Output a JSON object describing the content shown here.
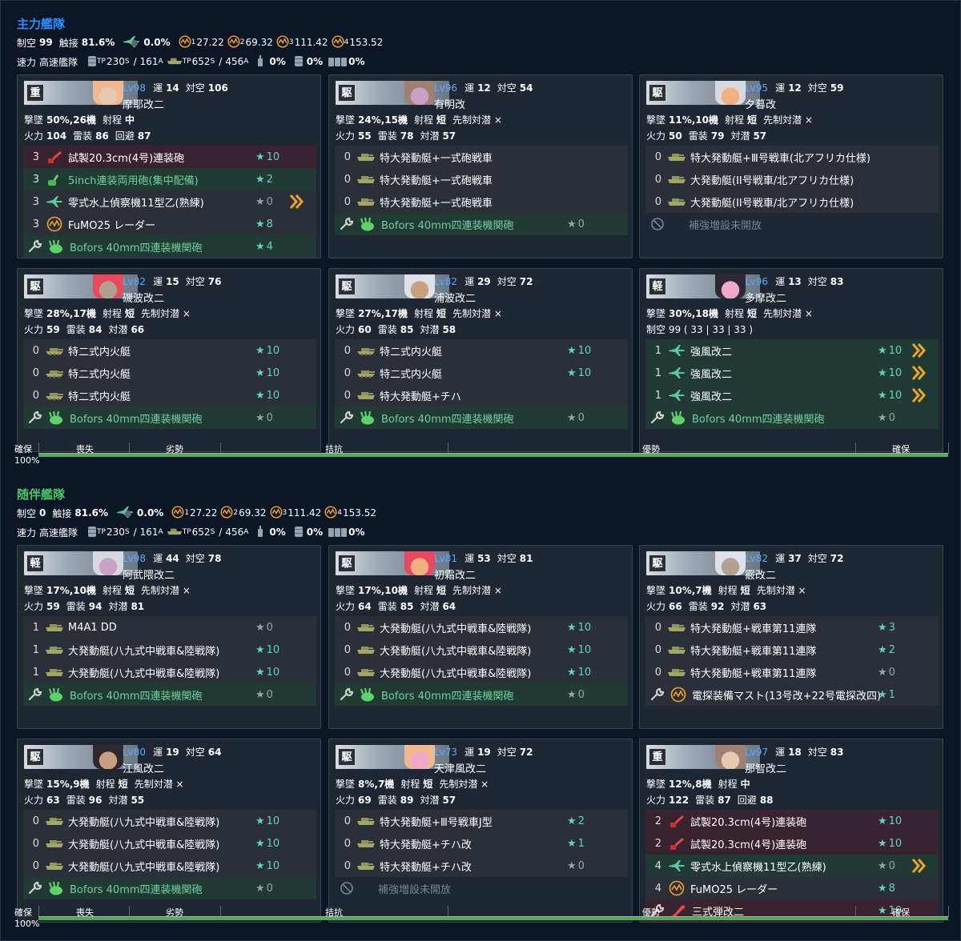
{
  "colors": {
    "main_title": "#2f8fff",
    "escort_title": "#4cc46b",
    "level": "#5fa8ff",
    "star": "#5fd4c4",
    "bar": "#58a85a"
  },
  "fleets": [
    {
      "title": "主力艦隊",
      "air": "99",
      "contact": "81.6%",
      "loss": "0.0%",
      "ls1": "27.22",
      "ls2": "69.32",
      "ls3": "111.42",
      "ls4": "153.52",
      "speed": "高速艦隊",
      "tp_s": "230",
      "tp_a": "161",
      "tp2_s": "652",
      "tp2_a": "456",
      "d1": "0%",
      "d2": "0%",
      "d3": "0%",
      "labels": {
        "air": "制空",
        "contact": "触接",
        "speed": "速力",
        "s1": "1",
        "s2": "2",
        "s3": "3",
        "s4": "4",
        "tp": "TP",
        "s": "S",
        "a": "A",
        "slash": "/"
      },
      "bar": {
        "kakuho": "確保",
        "soushitsu": "喪失",
        "ressei": "劣勢",
        "kikou": "拮抗",
        "yusei": "優勢",
        "kakuho2": "確保",
        "pct": "100%"
      },
      "ships": [
        {
          "type": "重",
          "lv": "Lv98",
          "luck": "14",
          "asw_label": "対空",
          "asw": "106",
          "name": "摩耶改二",
          "l2": "撃墜",
          "l2v": "50%,26機",
          "range_label": "射程",
          "range": "中",
          "extra": "",
          "stats": [
            [
              "火力",
              "104"
            ],
            [
              "雷装",
              "86"
            ],
            [
              "回避",
              "87"
            ]
          ],
          "row4": "",
          "slots": [
            {
              "c": "3",
              "ic": "gun-red",
              "bg": "bg-red",
              "n": "試製20.3cm(4号)連装砲",
              "st": "10",
              "g": false,
              "p": false
            },
            {
              "c": "3",
              "ic": "gun-green",
              "bg": "bg-green",
              "n": "5inch連装両用砲(集中配備)",
              "st": "2",
              "g": false,
              "p": false,
              "ncls": "ex-green"
            },
            {
              "c": "3",
              "ic": "plane-green",
              "bg": "bg-dark",
              "n": "零式水上偵察機11型乙(熟練)",
              "st": "0",
              "g": true,
              "p": true
            },
            {
              "c": "3",
              "ic": "radar",
              "bg": "bg-dark",
              "n": "FuMO25 レーダー",
              "st": "8",
              "g": false,
              "p": false
            }
          ],
          "ex": {
            "ic": "aa-green",
            "n": "Bofors 40mm四連装機関砲",
            "st": "4",
            "g": false
          }
        },
        {
          "type": "駆",
          "lv": "Lv96",
          "luck": "12",
          "asw_label": "対空",
          "asw": "54",
          "name": "有明改",
          "l2": "撃墜",
          "l2v": "24%,15機",
          "range_label": "射程",
          "range": "短",
          "extra": "先制対潜 ×",
          "stats": [
            [
              "火力",
              "55"
            ],
            [
              "雷装",
              "78"
            ],
            [
              "対潜",
              "57"
            ]
          ],
          "row4": "",
          "slots": [
            {
              "c": "0",
              "ic": "boat",
              "bg": "bg-dark",
              "n": "特大発動艇+一式砲戦車",
              "st": "",
              "g": false,
              "p": false
            },
            {
              "c": "0",
              "ic": "boat",
              "bg": "bg-dark",
              "n": "特大発動艇+一式砲戦車",
              "st": "",
              "g": false,
              "p": false
            },
            {
              "c": "0",
              "ic": "boat",
              "bg": "bg-dark",
              "n": "特大発動艇+一式砲戦車",
              "st": "",
              "g": false,
              "p": false
            }
          ],
          "ex": {
            "ic": "aa-green",
            "n": "Bofors 40mm四連装機関砲",
            "st": "0",
            "g": true
          }
        },
        {
          "type": "駆",
          "lv": "Lv95",
          "luck": "12",
          "asw_label": "対空",
          "asw": "59",
          "name": "夕暮改",
          "l2": "撃墜",
          "l2v": "11%,10機",
          "range_label": "射程",
          "range": "短",
          "extra": "先制対潜 ×",
          "stats": [
            [
              "火力",
              "50"
            ],
            [
              "雷装",
              "79"
            ],
            [
              "対潜",
              "57"
            ]
          ],
          "row4": "",
          "slots": [
            {
              "c": "0",
              "ic": "boat",
              "bg": "bg-dark",
              "n": "特大発動艇+Ⅲ号戦車(北アフリカ仕様)",
              "st": "",
              "g": false,
              "p": false
            },
            {
              "c": "0",
              "ic": "boat",
              "bg": "bg-dark",
              "n": "大発動艇(II号戦車/北アフリカ仕様)",
              "st": "",
              "g": false,
              "p": false
            },
            {
              "c": "0",
              "ic": "boat",
              "bg": "bg-dark",
              "n": "大発動艇(II号戦車/北アフリカ仕様)",
              "st": "",
              "g": false,
              "p": false
            }
          ],
          "ex": {
            "ic": "none",
            "n": "補強増設未開放",
            "st": "",
            "g": false,
            "closed": true
          }
        },
        {
          "type": "駆",
          "lv": "Lv82",
          "luck": "15",
          "asw_label": "対空",
          "asw": "76",
          "name": "磯波改二",
          "l2": "撃墜",
          "l2v": "28%,17機",
          "range_label": "射程",
          "range": "短",
          "extra": "先制対潜 ×",
          "stats": [
            [
              "火力",
              "59"
            ],
            [
              "雷装",
              "84"
            ],
            [
              "対潜",
              "66"
            ]
          ],
          "row4": "",
          "slots": [
            {
              "c": "0",
              "ic": "boat2",
              "bg": "bg-dark",
              "n": "特二式内火艇",
              "st": "10",
              "g": false,
              "p": false
            },
            {
              "c": "0",
              "ic": "boat2",
              "bg": "bg-dark",
              "n": "特二式内火艇",
              "st": "10",
              "g": false,
              "p": false
            },
            {
              "c": "0",
              "ic": "boat2",
              "bg": "bg-dark",
              "n": "特二式内火艇",
              "st": "10",
              "g": false,
              "p": false
            }
          ],
          "ex": {
            "ic": "aa-green",
            "n": "Bofors 40mm四連装機関砲",
            "st": "0",
            "g": true
          }
        },
        {
          "type": "駆",
          "lv": "Lv82",
          "luck": "29",
          "asw_label": "対空",
          "asw": "72",
          "name": "浦波改二",
          "l2": "撃墜",
          "l2v": "27%,17機",
          "range_label": "射程",
          "range": "短",
          "extra": "先制対潜 ×",
          "stats": [
            [
              "火力",
              "60"
            ],
            [
              "雷装",
              "85"
            ],
            [
              "対潜",
              "58"
            ]
          ],
          "row4": "",
          "slots": [
            {
              "c": "0",
              "ic": "boat2",
              "bg": "bg-dark",
              "n": "特二式内火艇",
              "st": "10",
              "g": false,
              "p": false
            },
            {
              "c": "0",
              "ic": "boat2",
              "bg": "bg-dark",
              "n": "特二式内火艇",
              "st": "10",
              "g": false,
              "p": false
            },
            {
              "c": "0",
              "ic": "boat",
              "bg": "bg-dark",
              "n": "特大発動艇+チハ",
              "st": "",
              "g": false,
              "p": false
            }
          ],
          "ex": {
            "ic": "aa-green",
            "n": "Bofors 40mm四連装機関砲",
            "st": "0",
            "g": true
          }
        },
        {
          "type": "軽",
          "lv": "Lv96",
          "luck": "13",
          "asw_label": "対空",
          "asw": "83",
          "name": "多摩改二",
          "l2": "撃墜",
          "l2v": "30%,18機",
          "range_label": "射程",
          "range": "短",
          "extra": "先制対潜 ×",
          "stats": [],
          "row4": "制空 99 ( 33 | 33 | 33 )",
          "slots": [
            {
              "c": "1",
              "ic": "plane-green",
              "bg": "bg-green",
              "n": "強風改二",
              "st": "10",
              "g": false,
              "p": true
            },
            {
              "c": "1",
              "ic": "plane-green",
              "bg": "bg-green",
              "n": "強風改二",
              "st": "10",
              "g": false,
              "p": true
            },
            {
              "c": "1",
              "ic": "plane-green",
              "bg": "bg-green",
              "n": "強風改二",
              "st": "10",
              "g": false,
              "p": true
            }
          ],
          "ex": {
            "ic": "aa-green",
            "n": "Bofors 40mm四連装機関砲",
            "st": "0",
            "g": true
          }
        }
      ]
    },
    {
      "title": "随伴艦隊",
      "air": "0",
      "contact": "81.6%",
      "loss": "0.0%",
      "ls1": "27.22",
      "ls2": "69.32",
      "ls3": "111.42",
      "ls4": "153.52",
      "speed": "高速艦隊",
      "tp_s": "230",
      "tp_a": "161",
      "tp2_s": "652",
      "tp2_a": "456",
      "d1": "0%",
      "d2": "0%",
      "d3": "0%",
      "labels": {
        "air": "制空",
        "contact": "触接",
        "speed": "速力",
        "s1": "1",
        "s2": "2",
        "s3": "3",
        "s4": "4",
        "tp": "TP",
        "s": "S",
        "a": "A",
        "slash": "/"
      },
      "bar": {
        "kakuho": "確保",
        "soushitsu": "喪失",
        "ressei": "劣勢",
        "kikou": "拮抗",
        "yusei": "優勢",
        "kakuho2": "確保",
        "pct": "100%"
      },
      "ships": [
        {
          "type": "軽",
          "lv": "Lv98",
          "luck": "44",
          "asw_label": "対空",
          "asw": "78",
          "name": "阿武隈改二",
          "l2": "撃墜",
          "l2v": "17%,10機",
          "range_label": "射程",
          "range": "短",
          "extra": "先制対潜 ×",
          "stats": [
            [
              "火力",
              "59"
            ],
            [
              "雷装",
              "94"
            ],
            [
              "対潜",
              "81"
            ]
          ],
          "row4": "",
          "slots": [
            {
              "c": "1",
              "ic": "boat",
              "bg": "bg-dark",
              "n": "M4A1 DD",
              "st": "0",
              "g": true,
              "p": false
            },
            {
              "c": "1",
              "ic": "boat",
              "bg": "bg-dark",
              "n": "大発動艇(八九式中戦車&陸戦隊)",
              "st": "10",
              "g": false,
              "p": false
            },
            {
              "c": "1",
              "ic": "boat",
              "bg": "bg-dark",
              "n": "大発動艇(八九式中戦車&陸戦隊)",
              "st": "10",
              "g": false,
              "p": false
            }
          ],
          "ex": {
            "ic": "aa-green",
            "n": "Bofors 40mm四連装機関砲",
            "st": "0",
            "g": true
          }
        },
        {
          "type": "駆",
          "lv": "Lv81",
          "luck": "53",
          "asw_label": "対空",
          "asw": "81",
          "name": "初霜改二",
          "l2": "撃墜",
          "l2v": "17%,10機",
          "range_label": "射程",
          "range": "短",
          "extra": "先制対潜 ×",
          "stats": [
            [
              "火力",
              "64"
            ],
            [
              "雷装",
              "85"
            ],
            [
              "対潜",
              "64"
            ]
          ],
          "row4": "",
          "slots": [
            {
              "c": "0",
              "ic": "boat",
              "bg": "bg-dark",
              "n": "大発動艇(八九式中戦車&陸戦隊)",
              "st": "10",
              "g": false,
              "p": false
            },
            {
              "c": "0",
              "ic": "boat",
              "bg": "bg-dark",
              "n": "大発動艇(八九式中戦車&陸戦隊)",
              "st": "10",
              "g": false,
              "p": false
            },
            {
              "c": "0",
              "ic": "boat",
              "bg": "bg-dark",
              "n": "大発動艇(八九式中戦車&陸戦隊)",
              "st": "10",
              "g": false,
              "p": false
            }
          ],
          "ex": {
            "ic": "aa-green",
            "n": "Bofors 40mm四連装機関砲",
            "st": "0",
            "g": true
          }
        },
        {
          "type": "駆",
          "lv": "Lv82",
          "luck": "37",
          "asw_label": "対空",
          "asw": "72",
          "name": "霰改二",
          "l2": "撃墜",
          "l2v": "10%,7機",
          "range_label": "射程",
          "range": "短",
          "extra": "先制対潜 ×",
          "stats": [
            [
              "火力",
              "66"
            ],
            [
              "雷装",
              "92"
            ],
            [
              "対潜",
              "63"
            ]
          ],
          "row4": "",
          "slots": [
            {
              "c": "0",
              "ic": "boat",
              "bg": "bg-dark",
              "n": "特大発動艇+戦車第11連隊",
              "st": "3",
              "g": false,
              "p": false
            },
            {
              "c": "0",
              "ic": "boat",
              "bg": "bg-dark",
              "n": "特大発動艇+戦車第11連隊",
              "st": "2",
              "g": false,
              "p": false
            },
            {
              "c": "0",
              "ic": "boat",
              "bg": "bg-dark",
              "n": "特大発動艇+戦車第11連隊",
              "st": "0",
              "g": true,
              "p": false
            }
          ],
          "ex": {
            "ic": "radar",
            "n": "電探装備マスト(13号改+22号電探改四)",
            "st": "1",
            "g": false,
            "white": true
          }
        },
        {
          "type": "駆",
          "lv": "Lv80",
          "luck": "19",
          "asw_label": "対空",
          "asw": "64",
          "name": "江風改二",
          "l2": "撃墜",
          "l2v": "15%,9機",
          "range_label": "射程",
          "range": "短",
          "extra": "先制対潜 ×",
          "stats": [
            [
              "火力",
              "63"
            ],
            [
              "雷装",
              "96"
            ],
            [
              "対潜",
              "55"
            ]
          ],
          "row4": "",
          "slots": [
            {
              "c": "0",
              "ic": "boat",
              "bg": "bg-dark",
              "n": "大発動艇(八九式中戦車&陸戦隊)",
              "st": "10",
              "g": false,
              "p": false
            },
            {
              "c": "0",
              "ic": "boat",
              "bg": "bg-dark",
              "n": "大発動艇(八九式中戦車&陸戦隊)",
              "st": "10",
              "g": false,
              "p": false
            },
            {
              "c": "0",
              "ic": "boat",
              "bg": "bg-dark",
              "n": "大発動艇(八九式中戦車&陸戦隊)",
              "st": "10",
              "g": false,
              "p": false
            }
          ],
          "ex": {
            "ic": "aa-green",
            "n": "Bofors 40mm四連装機関砲",
            "st": "0",
            "g": true
          }
        },
        {
          "type": "駆",
          "lv": "Lv73",
          "luck": "19",
          "asw_label": "対空",
          "asw": "72",
          "name": "天津風改二",
          "l2": "撃墜",
          "l2v": "8%,7機",
          "range_label": "射程",
          "range": "短",
          "extra": "先制対潜 ×",
          "stats": [
            [
              "火力",
              "69"
            ],
            [
              "雷装",
              "89"
            ],
            [
              "対潜",
              "57"
            ]
          ],
          "row4": "",
          "slots": [
            {
              "c": "0",
              "ic": "boat",
              "bg": "bg-dark",
              "n": "特大発動艇+Ⅲ号戦車J型",
              "st": "2",
              "g": false,
              "p": false
            },
            {
              "c": "0",
              "ic": "boat",
              "bg": "bg-dark",
              "n": "特大発動艇+チハ改",
              "st": "1",
              "g": false,
              "p": false
            },
            {
              "c": "0",
              "ic": "boat",
              "bg": "bg-dark",
              "n": "特大発動艇+チハ改",
              "st": "0",
              "g": true,
              "p": false
            }
          ],
          "ex": {
            "ic": "none",
            "n": "補強増設未開放",
            "st": "",
            "g": false,
            "closed": true
          }
        },
        {
          "type": "重",
          "lv": "Lv97",
          "luck": "18",
          "asw_label": "対空",
          "asw": "83",
          "name": "那智改二",
          "l2": "撃墜",
          "l2v": "12%,8機",
          "range_label": "射程",
          "range": "中",
          "extra": "",
          "stats": [
            [
              "火力",
              "122"
            ],
            [
              "雷装",
              "87"
            ],
            [
              "回避",
              "88"
            ]
          ],
          "row4": "",
          "slots": [
            {
              "c": "2",
              "ic": "gun-red",
              "bg": "bg-red",
              "n": "試製20.3cm(4号)連装砲",
              "st": "10",
              "g": false,
              "p": false
            },
            {
              "c": "2",
              "ic": "gun-red",
              "bg": "bg-red",
              "n": "試製20.3cm(4号)連装砲",
              "st": "10",
              "g": false,
              "p": false
            },
            {
              "c": "4",
              "ic": "plane-green",
              "bg": "bg-green",
              "n": "零式水上偵察機11型乙(熟練)",
              "st": "0",
              "g": true,
              "p": true
            },
            {
              "c": "4",
              "ic": "radar",
              "bg": "bg-dark",
              "n": "FuMO25 レーダー",
              "st": "8",
              "g": false,
              "p": false
            }
          ],
          "ex": {
            "ic": "shell",
            "n": "三式弾改二",
            "st": "10",
            "g": false,
            "white": true,
            "bg": "bg-red"
          }
        }
      ]
    }
  ],
  "star_symbol": "★",
  "count_label": {
    "cnt": "運"
  }
}
